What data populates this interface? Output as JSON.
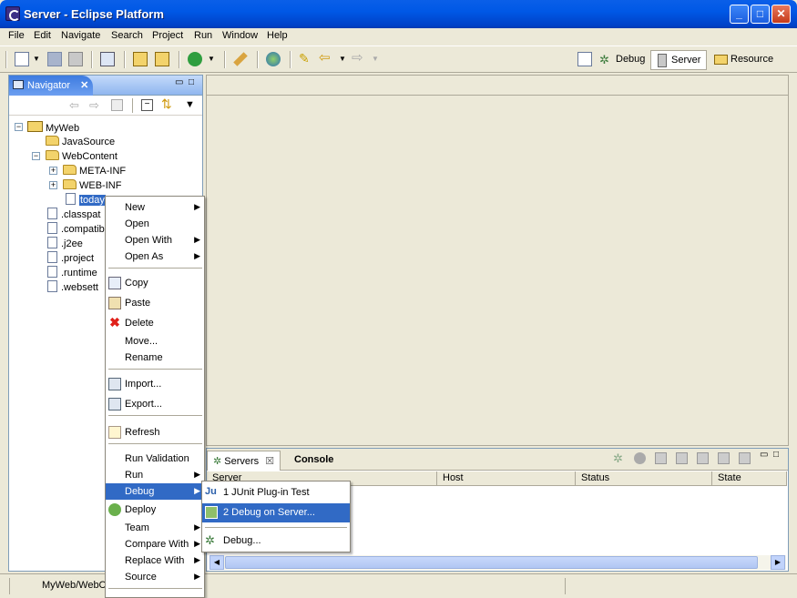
{
  "window": {
    "title": "Server - Eclipse Platform",
    "min": "_",
    "max": "□",
    "close": "✕"
  },
  "menubar": [
    "File",
    "Edit",
    "Navigate",
    "Search",
    "Project",
    "Run",
    "Window",
    "Help"
  ],
  "perspectives": {
    "debug": "Debug",
    "server": "Server",
    "resource": "Resource"
  },
  "navigator": {
    "tab_label": "Navigator",
    "close": "✕",
    "tree": {
      "project": "MyWeb",
      "items": [
        "JavaSource",
        "WebContent",
        "META-INF",
        "WEB-INF",
        "today",
        ".classpat",
        ".compatib",
        ".j2ee",
        ".project",
        ".runtime",
        ".websett"
      ]
    }
  },
  "context_menu": {
    "items": [
      "New",
      "Open",
      "Open With",
      "Open As",
      "Copy",
      "Paste",
      "Delete",
      "Move...",
      "Rename",
      "Import...",
      "Export...",
      "Refresh",
      "Run Validation",
      "Run",
      "Debug",
      "Deploy",
      "Team",
      "Compare With",
      "Replace With",
      "Source"
    ]
  },
  "debug_submenu": {
    "items": [
      "1 JUnit Plug-in Test",
      "2 Debug on Server...",
      "Debug..."
    ]
  },
  "servers_panel": {
    "tabs": {
      "servers": "Servers",
      "console": "Console"
    },
    "columns": [
      "Server",
      "Host",
      "Status",
      "State"
    ]
  },
  "statusbar": {
    "path": "MyWeb/WebC"
  },
  "colors": {
    "selection": "#316ac5",
    "titlebar": "#0058e6"
  }
}
